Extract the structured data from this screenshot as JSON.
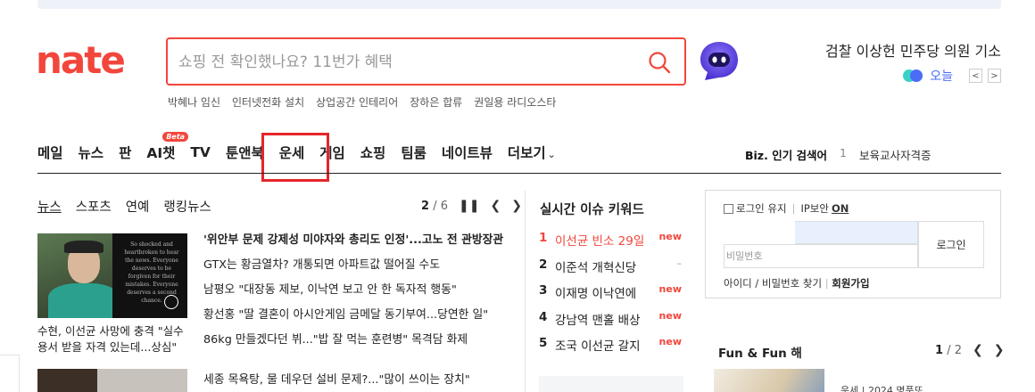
{
  "brand": {
    "logo_text": "nate",
    "color": "#f2463c"
  },
  "search": {
    "placeholder": "쇼핑 전 확인했나요? 11번가 혜택",
    "icon": "search-icon"
  },
  "headline_right": "검찰 이상헌 민주당 의원 기소",
  "today": {
    "label": "오늘",
    "prev": "<",
    "next": ">"
  },
  "keywords": [
    "박혜나 임신",
    "인터넷전화 설치",
    "상업공간 인테리어",
    "장하은 합류",
    "권일용 라디오스타"
  ],
  "gnb": {
    "items": [
      "메일",
      "뉴스",
      "판",
      "AI챗",
      "TV",
      "툰앤북",
      "운세",
      "게임",
      "쇼핑",
      "팀룸",
      "네이트뷰",
      "더보기"
    ],
    "beta": "Beta"
  },
  "biz": {
    "label": "Biz. 인기 검색어",
    "rank": "1",
    "word": "보육교사자격증"
  },
  "news": {
    "tabs": [
      "뉴스",
      "스포츠",
      "연예",
      "랭킹뉴스"
    ],
    "page_current": "2",
    "page_total": "/ 6",
    "thumb_caption": "수현, 이선균 사망에 충격 \"실수 용서 받을 자격 있는데...상심\"",
    "thumb_text": "So shocked and heartbroken to hear the news. Everyone deserves to be forgiven for their mistakes. Everyone deserves a second chance.",
    "items": [
      "'위안부 문제 강제성 미야자와 총리도 인정'...고노 전 관방장관",
      "GTX는 황금열차? 개통되면 아파트값 떨어질 수도",
      "남평오 \"대장동 제보, 이낙연 보고 안 한 독자적 행동\"",
      "황선홍 \"딸 결혼이 아시안게임 금메달 동기부여...당연한 일\"",
      "86kg 만들겠다던 뷔...\"밥 잘 먹는 훈련병\" 목격담 화제"
    ],
    "item_next": "세종 목욕탕, 물 데우던 설비 문제?...\"많이 쓰이는 장치\""
  },
  "realtime": {
    "title": "실시간 이슈 키워드",
    "items": [
      {
        "rank": "1",
        "word": "이선균 빈소 29일",
        "status": "new"
      },
      {
        "rank": "2",
        "word": "이준석 개혁신당",
        "status": "–"
      },
      {
        "rank": "3",
        "word": "이재명 이낙연에",
        "status": "new"
      },
      {
        "rank": "4",
        "word": "강남역 맨홀 배상",
        "status": "new"
      },
      {
        "rank": "5",
        "word": "조국 이선균 갈지",
        "status": "new"
      }
    ]
  },
  "login": {
    "keep_label": "로그인 유지",
    "ip_label": "IP보안",
    "ip_state": "ON",
    "pw_placeholder": "비밀번호",
    "button": "로그인",
    "find": "아이디 / 비밀번호 찾기",
    "join": "회원가입"
  },
  "fun": {
    "title": "Fun & Fun 해",
    "page_current": "1",
    "page_total": "/ 2",
    "item": "운세 | 2024 명품또"
  }
}
